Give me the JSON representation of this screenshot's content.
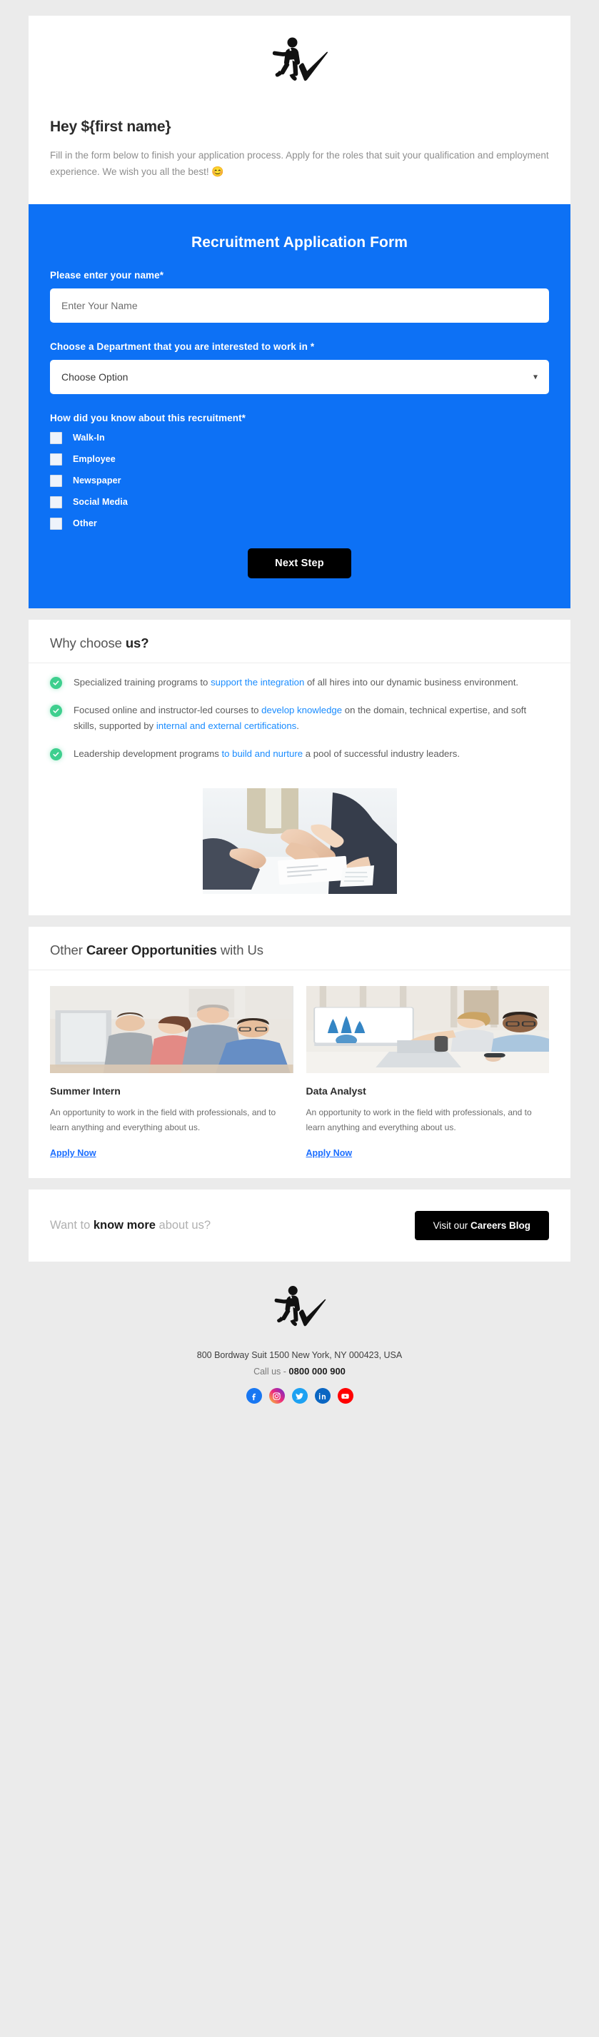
{
  "brand": {
    "logo_icon": "running-person-checkmark-logo"
  },
  "hero": {
    "greeting": "Hey ${first name}",
    "intro": "Fill in the form below to finish your application process. Apply for the roles that suit your qualification and employment experience. We wish you all the best!",
    "intro_emoji": "😊"
  },
  "form": {
    "title": "Recruitment Application Form",
    "name_label": "Please enter your name*",
    "name_placeholder": "Enter Your Name",
    "name_value": "",
    "department_label": "Choose a Department that you are interested to work in *",
    "department_selected": "Choose Option",
    "department_options": [
      "Choose Option"
    ],
    "source_label": "How did you know about this recruitment*",
    "source_options": [
      {
        "label": "Walk-In",
        "checked": false
      },
      {
        "label": "Employee",
        "checked": false
      },
      {
        "label": "Newspaper",
        "checked": false
      },
      {
        "label": "Social Media",
        "checked": false
      },
      {
        "label": "Other",
        "checked": false
      }
    ],
    "next_button": "Next Step",
    "accent_color": "#0d71f5",
    "button_color": "#000000"
  },
  "why": {
    "heading_prefix": "Why choose ",
    "heading_strong": "us?",
    "bullet_icon": "green-check-circle-icon",
    "items": [
      {
        "pre": "Specialized training programs to ",
        "link": "support the integration",
        "post": " of all hires into our dynamic business environment."
      },
      {
        "pre": "Focused online and instructor-led courses to ",
        "link": "develop knowledge",
        "mid": " on the domain, technical expertise, and soft skills, supported by ",
        "link2": "internal and external certifications",
        "post": "."
      },
      {
        "pre": "Leadership development programs ",
        "link": "to build and nurture",
        "post": " a pool of successful industry leaders."
      }
    ],
    "photo_alt": "business-handshake-photo",
    "link_color": "#1a8cff"
  },
  "careers": {
    "heading_prefix": "Other ",
    "heading_strong": "Career Opportunities",
    "heading_suffix": " with Us",
    "jobs": [
      {
        "photo_alt": "team-at-computer-photo",
        "title": "Summer Intern",
        "desc": "An opportunity to work in the field with professionals, and to learn anything and everything about us.",
        "cta": "Apply Now"
      },
      {
        "photo_alt": "analysts-reviewing-chart-photo",
        "title": "Data Analyst",
        "desc": "An opportunity to work in the field with professionals, and to learn anything and everything about us.",
        "cta": "Apply Now"
      }
    ]
  },
  "cta": {
    "text_pre": "Want to ",
    "text_strong": "know more",
    "text_post": " about us?",
    "button_pre": "Visit our ",
    "button_strong": "Careers Blog"
  },
  "footer": {
    "logo_icon": "running-person-checkmark-logo",
    "address": "800 Bordway Suit 1500 New York, NY 000423, USA",
    "call_label": "Call us - ",
    "phone": "0800 000 900",
    "social": [
      {
        "name": "facebook-icon",
        "color": "#1877f2"
      },
      {
        "name": "instagram-icon",
        "color": "#ee2a7b"
      },
      {
        "name": "twitter-icon",
        "color": "#1da1f2"
      },
      {
        "name": "linkedin-icon",
        "color": "#0a66c2"
      },
      {
        "name": "youtube-icon",
        "color": "#ff0000"
      }
    ]
  }
}
